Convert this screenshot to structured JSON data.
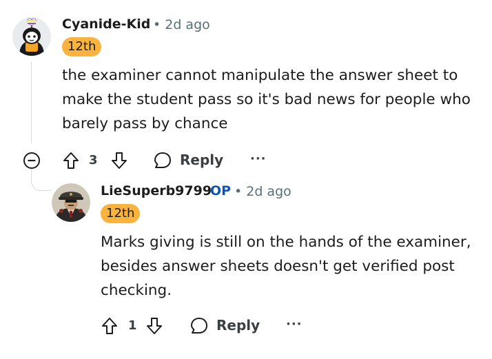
{
  "comments": [
    {
      "author": "Cyanide-Kid",
      "timestamp": "• 2d ago",
      "flair": "12th",
      "body": [
        "the examiner cannot manipulate the answer sheet to",
        "make the student pass so it's bad news for people who",
        "barely pass by chance"
      ],
      "votes": "3",
      "reply_label": "Reply",
      "more_label": "···"
    },
    {
      "author": "LieSuperb9799",
      "op_badge": "OP",
      "timestamp": "• 2d ago",
      "flair": "12th",
      "body": [
        "Marks giving is still on the hands of the examiner,",
        "besides answer sheets doesn't get verified post",
        "checking."
      ],
      "votes": "1",
      "reply_label": "Reply",
      "more_label": "···"
    }
  ],
  "colors": {
    "flair_bg": "#fbb33f",
    "op_blue": "#0a56b4",
    "meta_gray": "#576f76",
    "thread_line": "#d6dadc"
  },
  "icons": [
    "collapse-thread-icon",
    "upvote-icon",
    "downvote-icon",
    "reply-bubble-icon",
    "overflow-menu-icon"
  ]
}
